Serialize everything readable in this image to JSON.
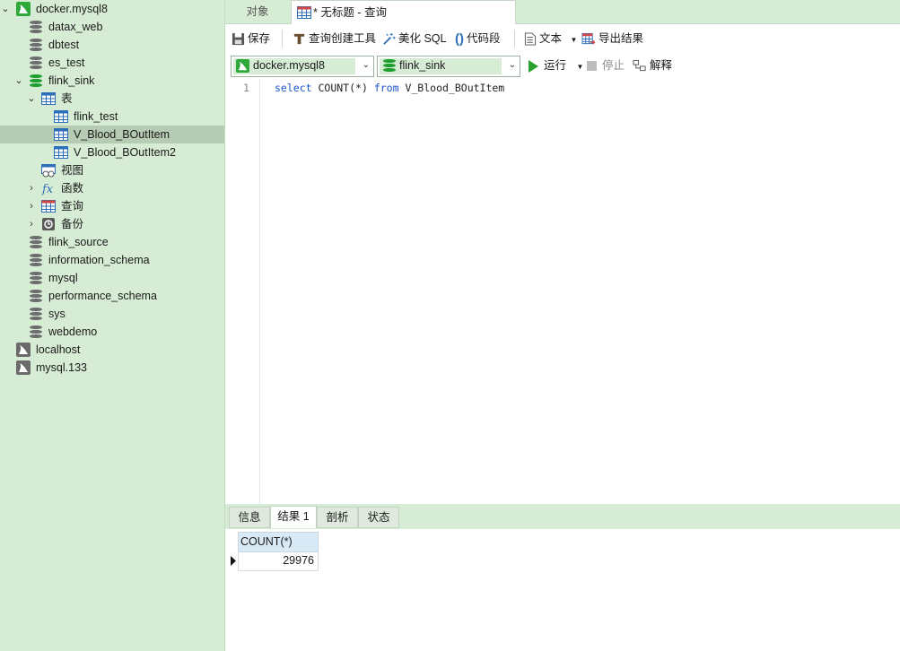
{
  "sidebar": {
    "items": [
      {
        "label": "docker.mysql8",
        "icon": "mysql-connection-icon",
        "state": "expanded"
      },
      {
        "label": "datax_web",
        "icon": "database-icon"
      },
      {
        "label": "dbtest",
        "icon": "database-icon"
      },
      {
        "label": "es_test",
        "icon": "database-icon"
      },
      {
        "label": "flink_sink",
        "icon": "database-icon",
        "state": "expanded"
      },
      {
        "label": "表",
        "icon": "tables-folder-icon",
        "state": "expanded"
      },
      {
        "label": "flink_test",
        "icon": "table-icon"
      },
      {
        "label": "V_Blood_BOutItem",
        "icon": "table-icon",
        "selected": true
      },
      {
        "label": "V_Blood_BOutItem2",
        "icon": "table-icon"
      },
      {
        "label": "视图",
        "icon": "views-folder-icon"
      },
      {
        "label": "函数",
        "icon": "function-icon",
        "state": "collapsed"
      },
      {
        "label": "查询",
        "icon": "query-folder-icon",
        "state": "collapsed"
      },
      {
        "label": "备份",
        "icon": "backup-icon",
        "state": "collapsed"
      },
      {
        "label": "flink_source",
        "icon": "database-icon"
      },
      {
        "label": "information_schema",
        "icon": "database-icon"
      },
      {
        "label": "mysql",
        "icon": "database-icon"
      },
      {
        "label": "performance_schema",
        "icon": "database-icon"
      },
      {
        "label": "sys",
        "icon": "database-icon"
      },
      {
        "label": "webdemo",
        "icon": "database-icon"
      },
      {
        "label": "localhost",
        "icon": "mysql-connection-icon"
      },
      {
        "label": "mysql.133",
        "icon": "mysql-connection-icon"
      }
    ]
  },
  "tabs": {
    "objects": "对象",
    "query": "* 无标题 - 查询"
  },
  "toolbar": {
    "save": "保存",
    "query_builder": "查询创建工具",
    "beautify": "美化 SQL",
    "snippet": "代码段",
    "text": "文本",
    "export": "导出结果",
    "connection": "docker.mysql8",
    "database": "flink_sink",
    "run": "运行",
    "stop": "停止",
    "explain": "解释"
  },
  "editor": {
    "line_number": "1",
    "kw_select": "select",
    "fn": "COUNT(*)",
    "kw_from": "from",
    "table": "V_Blood_BOutItem"
  },
  "results": {
    "tabs": [
      "信息",
      "结果 1",
      "剖析",
      "状态"
    ],
    "active_tab": "结果 1",
    "column": "COUNT(*)",
    "value": "29976"
  },
  "colors": {
    "sidebar_bg": "#d6ecd4",
    "selected_row": "#b6cbb3",
    "keyword": "#1a55c8",
    "run_green": "#2aa12e"
  }
}
